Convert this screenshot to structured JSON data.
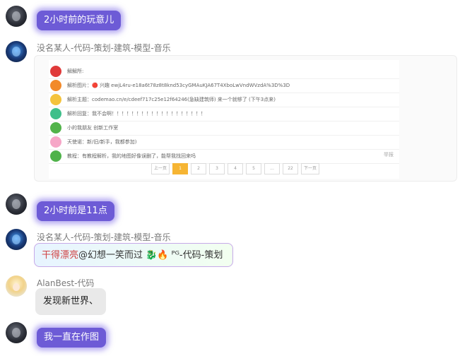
{
  "messages": {
    "m1": {
      "text": "2小时前的玩意儿"
    },
    "m2": {
      "sender": "没名某人-代码-策划-建筑-模型-音乐",
      "screenshot": {
        "rows": [
          {
            "text": "解解所:",
            "side": ""
          },
          {
            "text": "解析图片：🔴 兴趣 ewjL4ru-e18a6t78z8t8knd53cyGMAuKJA67T4XboLwVndWVzdA%3D%3D",
            "side": ""
          },
          {
            "text": "解析主题：codemao.cn/e/cdeef717c25e12f64246(急缺建筑师) 来一个就够了 (下午3点来)",
            "side": ""
          },
          {
            "text": "解析回复：我不会啊！！！！！！！！！！！！！！！！！！！",
            "side": ""
          },
          {
            "text": "小的我朋友 创新工作室",
            "side": ""
          },
          {
            "text": "天使诺：新/旧/新手，我都参加)",
            "side": ""
          },
          {
            "text": "教程：有教程解析，我的地图好像误删了，能帮我找回来吗",
            "side": "举报"
          }
        ],
        "pager": [
          "上一页",
          "1",
          "2",
          "3",
          "4",
          "5",
          "...",
          "22",
          "下一页"
        ],
        "active_page": "1"
      }
    },
    "m3": {
      "text": "2小时前是11点"
    },
    "m4": {
      "sender": "没名某人-代码-策划-建筑-模型-音乐",
      "text_red": "干得漂亮",
      "text_rest": "@幻想一笑而过 🐉🔥 ᴾᴳ-代码-策划"
    },
    "m5": {
      "sender": "AlanBest-代码",
      "text": "发现新世界、"
    },
    "m6": {
      "text": "我一直在作图"
    }
  }
}
